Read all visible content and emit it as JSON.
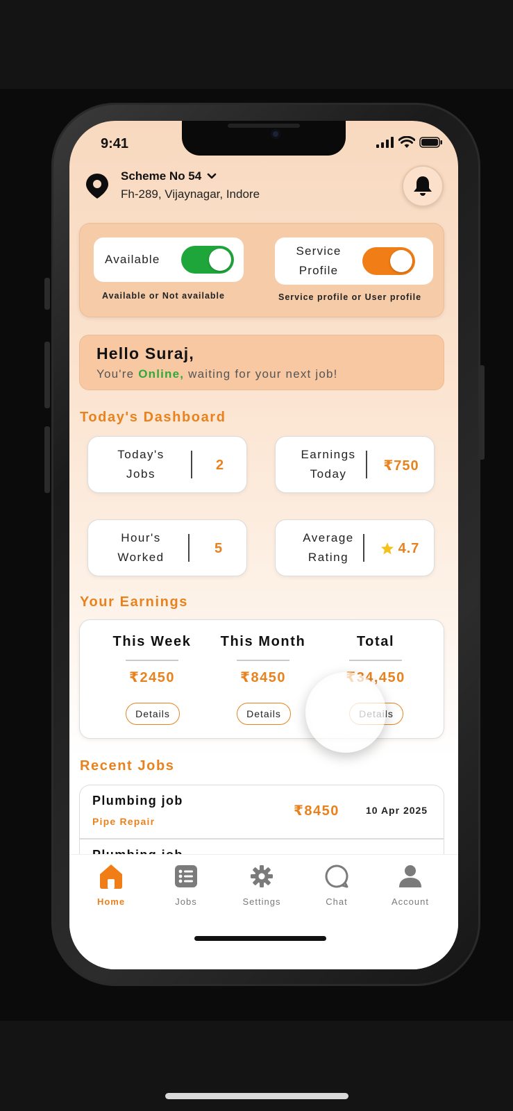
{
  "status_bar": {
    "time": "9:41"
  },
  "location": {
    "title": "Scheme No 54",
    "address": "Fh-289, Vijaynagar, Indore"
  },
  "toggles": {
    "available": {
      "label": "Available",
      "caption": "Available or Not available",
      "on": true,
      "color": "#1fa63a"
    },
    "service": {
      "label_line1": "Service",
      "label_line2": "Profile",
      "caption": "Service profile or User profile",
      "on": true,
      "color": "#f07d15"
    }
  },
  "greeting": {
    "title": "Hello Suraj,",
    "prefix": "You're ",
    "status": "Online,",
    "suffix": " waiting for your next job!"
  },
  "dashboard": {
    "title": "Today's Dashboard",
    "stats": [
      {
        "label_line1": "Today's",
        "label_line2": "Jobs",
        "value": "2"
      },
      {
        "label_line1": "Earnings",
        "label_line2": "Today",
        "value": "₹750"
      },
      {
        "label_line1": "Hour's",
        "label_line2": "Worked",
        "value": "5"
      },
      {
        "label_line1": "Average",
        "label_line2": "Rating",
        "value": "4.7"
      }
    ]
  },
  "earnings": {
    "title": "Your Earnings",
    "columns": [
      {
        "label": "This Week",
        "amount": "₹2450",
        "button": "Details"
      },
      {
        "label": "This Month",
        "amount": "₹8450",
        "button": "Details"
      },
      {
        "label": "Total",
        "amount": "₹34,450",
        "button": "Details"
      }
    ]
  },
  "recent_jobs": {
    "title": "Recent Jobs",
    "items": [
      {
        "title": "Plumbing job",
        "subtitle": "Pipe Repair",
        "amount": "₹8450",
        "date": "10 Apr 2025"
      },
      {
        "title": "Plumbing job",
        "subtitle": "",
        "amount": "",
        "date": ""
      }
    ]
  },
  "nav": {
    "items": [
      {
        "label": "Home",
        "icon": "home-icon",
        "active": true
      },
      {
        "label": "Jobs",
        "icon": "jobs-list-icon",
        "active": false
      },
      {
        "label": "Settings",
        "icon": "gear-icon",
        "active": false
      },
      {
        "label": "Chat",
        "icon": "chat-icon",
        "active": false
      },
      {
        "label": "Account",
        "icon": "user-icon",
        "active": false
      }
    ]
  },
  "colors": {
    "accent": "#e8821e",
    "online": "#2eaa3a",
    "star": "#f4c21b",
    "panel": "#f6cba8"
  }
}
